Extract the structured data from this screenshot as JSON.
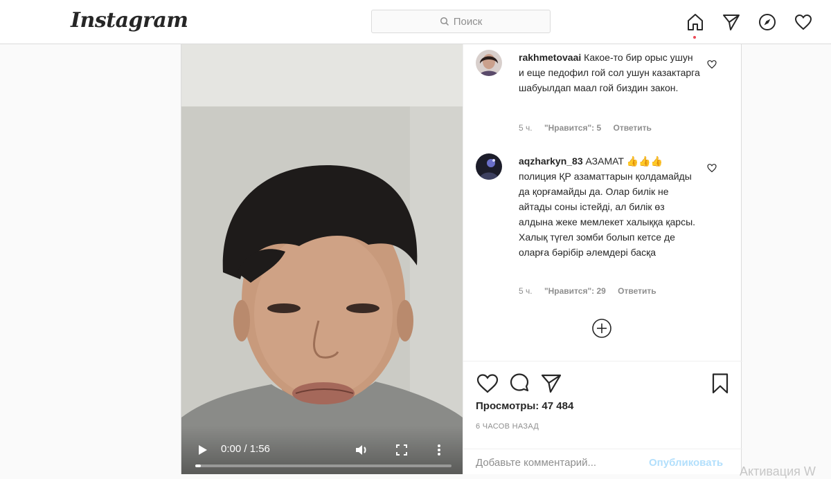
{
  "header": {
    "logo": "Instagram",
    "search_placeholder": "Поиск"
  },
  "video": {
    "time": "0:00 / 1:56",
    "progress": 0.0
  },
  "comments": [
    {
      "username": "rakhmetovaai",
      "text": "Какое-то бир орыс ушун и еще педофил гой сол ушун казактарга шабуылдап маал гой биздин закон.",
      "age": "5 ч.",
      "likes": "\"Нравится\": 5",
      "reply": "Ответить"
    },
    {
      "username": "aqzharkyn_83",
      "text": "АЗАМАТ 👍👍👍 полиция ҚР азаматтарын қолдамайды да қорғамайды да. Олар билік не айтады соны істейді, ал билік өз алдына жеке мемлекет халыққа қарсы. Халық түгел зомби болып кетсе де оларға бәрібір әлемдері басқа",
      "age": "5 ч.",
      "likes": "\"Нравится\": 29",
      "reply": "Ответить"
    }
  ],
  "post": {
    "views": "Просмотры: 47 484",
    "time_ago": "6 ЧАСОВ НАЗАД",
    "add_comment_placeholder": "Добавьте комментарий...",
    "publish_label": "Опубликовать"
  },
  "watermark": "Активация W"
}
